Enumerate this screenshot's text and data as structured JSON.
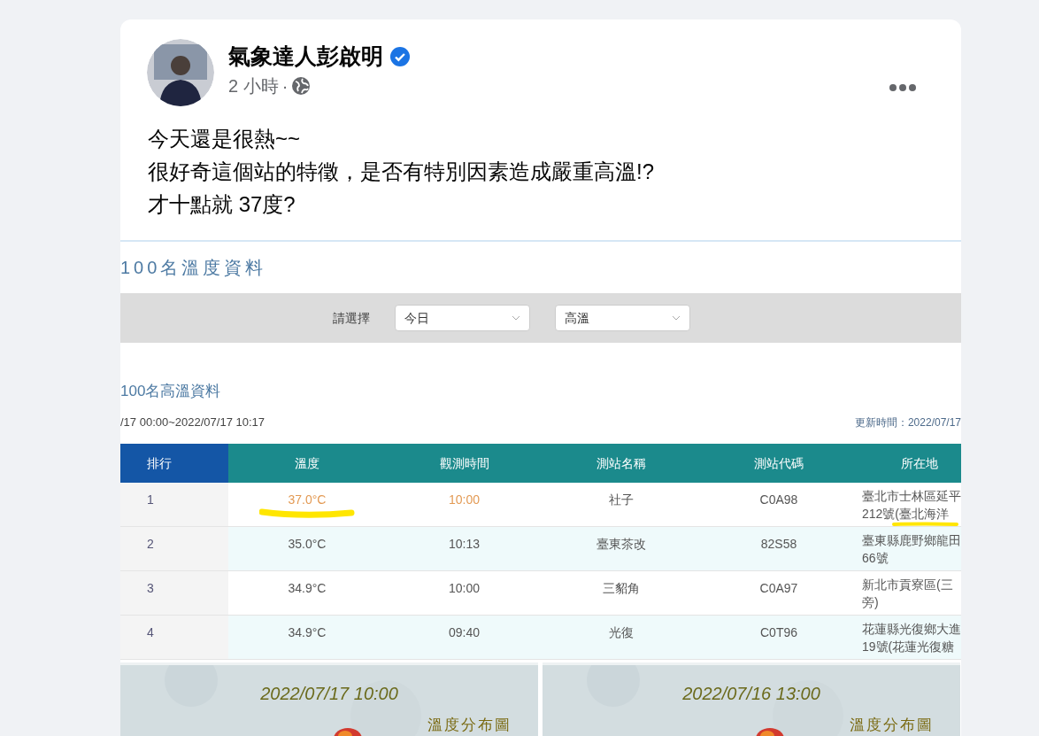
{
  "post": {
    "author": "氣象達人彭啟明",
    "verified": true,
    "time": "2 小時",
    "separator": "·",
    "text_lines": [
      "今天還是很熱~~",
      "很好奇這個站的特徵，是否有特別因素造成嚴重高溫!?",
      "才十點就 37度?"
    ]
  },
  "shared_image": {
    "page_title": "100名溫度資料",
    "filter_label": "請選擇",
    "selects": [
      {
        "value": "今日"
      },
      {
        "value": "高溫"
      }
    ],
    "section_title": "100名高溫資料",
    "range": "/17 00:00~2022/07/17 10:17",
    "updated": "更新時間：2022/07/17",
    "table": {
      "columns": [
        "排行",
        "溫度",
        "觀測時間",
        "測站名稱",
        "測站代碼",
        "所在地"
      ],
      "rows": [
        {
          "rank": "1",
          "temp": "37.0°C",
          "time": "10:00",
          "station": "社子",
          "code": "C0A98",
          "address": [
            "臺北市士林區延平",
            "212號(臺北海洋"
          ],
          "highlighted": true
        },
        {
          "rank": "2",
          "temp": "35.0°C",
          "time": "10:13",
          "station": "臺東茶改",
          "code": "82S58",
          "address": [
            "臺東縣鹿野鄉龍田",
            "66號"
          ],
          "highlighted": false
        },
        {
          "rank": "3",
          "temp": "34.9°C",
          "time": "10:00",
          "station": "三貂角",
          "code": "C0A97",
          "address": [
            "新北市貢寮區(三",
            "旁)"
          ],
          "highlighted": false
        },
        {
          "rank": "4",
          "temp": "34.9°C",
          "time": "09:40",
          "station": "光復",
          "code": "C0T96",
          "address": [
            "花蓮縣光復鄉大進",
            "19號(花蓮光復糖"
          ],
          "highlighted": false
        }
      ]
    },
    "maps": [
      {
        "kind": "picture",
        "date": "2022/07/17 10:00",
        "title": "溫度分布圖"
      },
      {
        "kind": "picture",
        "date": "2022/07/16 13:00",
        "title": "溫度分布圖"
      }
    ]
  }
}
